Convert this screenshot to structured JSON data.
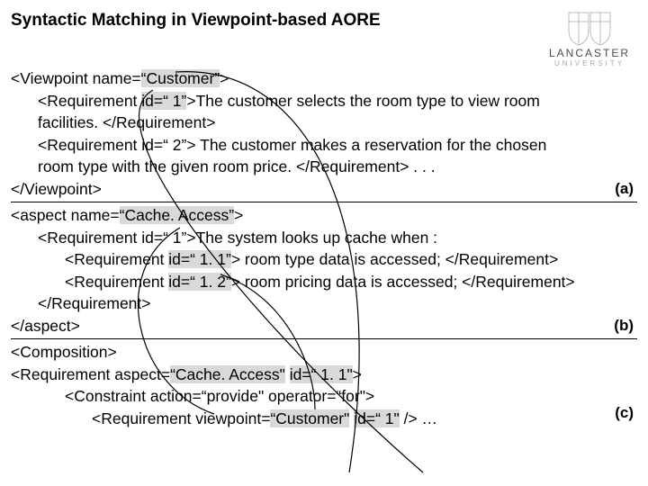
{
  "title": "Syntactic Matching in Viewpoint-based AORE",
  "logo": {
    "name": "LANCASTER",
    "sub": "UNIVERSITY"
  },
  "sectionA": {
    "label": "(a)",
    "l1a": "<Viewpoint name=",
    "l1b": "“Customer”",
    "l1c": ">",
    "l2a": "<Requirement ",
    "l2b": "id=“ 1”",
    "l2c": ">The customer selects the room type to view room",
    "l3": "facilities. </Requirement>",
    "l4": "<Requirement id=“ 2”> The customer makes a reservation for the chosen",
    "l5": "room type with the given room price. </Requirement> . . .",
    "l6": "</Viewpoint>"
  },
  "sectionB": {
    "label": "(b)",
    "l1a": "<aspect name=",
    "l1b": "“Cache. Access”",
    "l1c": ">",
    "l2": "<Requirement id=“ 1”>The system looks up cache when :",
    "l3a": "<Requirement ",
    "l3b": "id=“ 1. 1”",
    "l3c": "> room type data is accessed; </Requirement>",
    "l4a": "<Requirement ",
    "l4b": "id=“ 1. 2”",
    "l4c": "> room pricing data is accessed; </Requirement>",
    "l5": "</Requirement>",
    "l6": "</aspect>"
  },
  "sectionC": {
    "label": "(c)",
    "l1": "<Composition>",
    "l2a": "<Requirement aspect=",
    "l2b": "“Cache. Access\"",
    "l2c": " ",
    "l2d": "id=“ 1. 1\"",
    "l2e": ">",
    "l3": "<Constraint action=“provide\" operator=“for\">",
    "l4a": "<Requirement viewpoint=",
    "l4b": "“Customer\"",
    "l4c": " ",
    "l4d": "id=“ 1\"",
    "l4e": " /> …"
  }
}
